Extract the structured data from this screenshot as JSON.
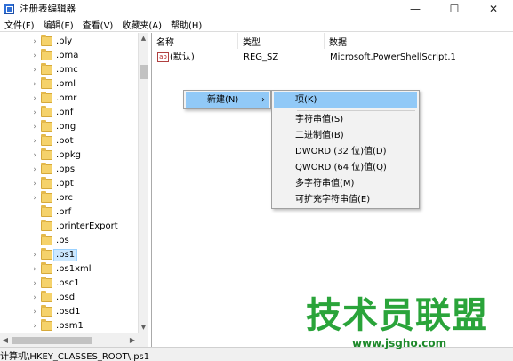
{
  "window": {
    "title": "注册表编辑器",
    "minimize": "—",
    "maximize": "☐",
    "close": "✕"
  },
  "menubar": [
    "文件(F)",
    "编辑(E)",
    "查看(V)",
    "收藏夹(A)",
    "帮助(H)"
  ],
  "tree": {
    "items": [
      {
        "label": ".ply",
        "expandable": true
      },
      {
        "label": ".pma",
        "expandable": true
      },
      {
        "label": ".pmc",
        "expandable": true
      },
      {
        "label": ".pml",
        "expandable": true
      },
      {
        "label": ".pmr",
        "expandable": true
      },
      {
        "label": ".pnf",
        "expandable": true
      },
      {
        "label": ".png",
        "expandable": true
      },
      {
        "label": ".pot",
        "expandable": true
      },
      {
        "label": ".ppkg",
        "expandable": true
      },
      {
        "label": ".pps",
        "expandable": true
      },
      {
        "label": ".ppt",
        "expandable": true
      },
      {
        "label": ".prc",
        "expandable": true
      },
      {
        "label": ".prf",
        "expandable": false
      },
      {
        "label": ".printerExport",
        "expandable": false
      },
      {
        "label": ".ps",
        "expandable": false
      },
      {
        "label": ".ps1",
        "expandable": true,
        "selected": true
      },
      {
        "label": ".ps1xml",
        "expandable": true
      },
      {
        "label": ".psc1",
        "expandable": true
      },
      {
        "label": ".psd",
        "expandable": true
      },
      {
        "label": ".psd1",
        "expandable": true
      },
      {
        "label": ".psm1",
        "expandable": true
      }
    ]
  },
  "columns": {
    "name": "名称",
    "type": "类型",
    "data": "数据"
  },
  "values": [
    {
      "icon": "ab",
      "name": "(默认)",
      "type": "REG_SZ",
      "data": "Microsoft.PowerShellScript.1"
    }
  ],
  "context_menu": {
    "new_label": "新建(N)",
    "arrow": "›"
  },
  "submenu": {
    "key": "项(K)",
    "items": [
      "字符串值(S)",
      "二进制值(B)",
      "DWORD (32 位)值(D)",
      "QWORD (64 位)值(Q)",
      "多字符串值(M)",
      "可扩充字符串值(E)"
    ]
  },
  "statusbar": {
    "path": "计算机\\HKEY_CLASSES_ROOT\\.ps1"
  },
  "watermark": {
    "title": "技术员联盟",
    "url": "www.jsgho.com"
  },
  "colors": {
    "selection": "#cce8ff",
    "menu_highlight": "#91c9f7",
    "watermark": "#2aa43a"
  },
  "icons": {
    "tree_item": "folder-icon",
    "value": "string-value-icon",
    "app": "regedit-icon"
  }
}
